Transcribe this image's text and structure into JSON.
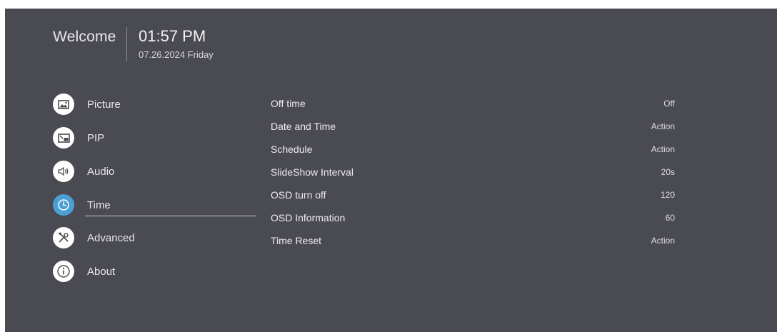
{
  "header": {
    "welcome": "Welcome",
    "time": "01:57 PM",
    "date": "07.26.2024 Friday"
  },
  "menu": {
    "items": [
      {
        "label": "Picture",
        "icon": "picture-icon"
      },
      {
        "label": "PIP",
        "icon": "pip-icon"
      },
      {
        "label": "Audio",
        "icon": "speaker-icon"
      },
      {
        "label": "Time",
        "icon": "clock-icon",
        "active": true
      },
      {
        "label": "Advanced",
        "icon": "tools-icon"
      },
      {
        "label": "About",
        "icon": "info-icon"
      }
    ]
  },
  "settings": {
    "rows": [
      {
        "label": "Off time",
        "value": "Off"
      },
      {
        "label": "Date and Time",
        "value": "Action"
      },
      {
        "label": "Schedule",
        "value": "Action"
      },
      {
        "label": "SlideShow Interval",
        "value": "20s"
      },
      {
        "label": "OSD turn off",
        "value": "120"
      },
      {
        "label": "OSD Information",
        "value": "60"
      },
      {
        "label": "Time Reset",
        "value": "Action"
      }
    ]
  },
  "colors": {
    "background": "#4a4a52",
    "accent": "#4aa0d4",
    "text": "#ffffff"
  }
}
